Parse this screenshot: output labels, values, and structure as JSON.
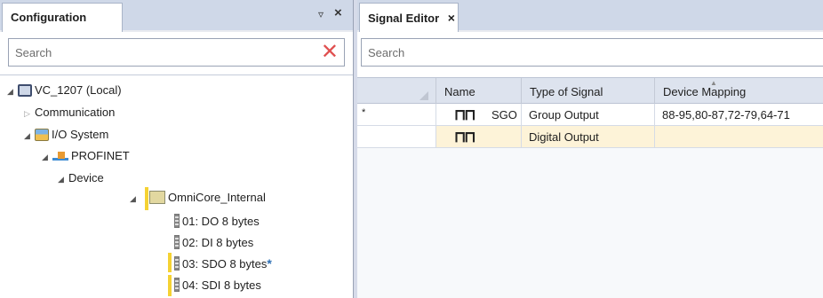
{
  "config_panel": {
    "tab_label": "Configuration",
    "pin_glyph": "⫿",
    "close_glyph": "×",
    "search_placeholder": "Search",
    "clear_glyph": "✕",
    "tree": {
      "root": "VC_1207 (Local)",
      "communication": "Communication",
      "io_system": "I/O System",
      "profinet": "PROFINET",
      "device": "Device",
      "omnicore": "OmniCore_Internal",
      "modules": [
        {
          "label": "01: DO 8 bytes",
          "modified": false,
          "highlighted": false
        },
        {
          "label": "02: DI 8 bytes",
          "modified": false,
          "highlighted": false
        },
        {
          "label": "03: SDO 8 bytes",
          "modified": true,
          "highlighted": true
        },
        {
          "label": "04: SDI 8 bytes",
          "modified": false,
          "highlighted": true
        }
      ],
      "modified_marker": "*"
    }
  },
  "signal_editor": {
    "tab_label": "Signal Editor",
    "close_glyph": "×",
    "search_placeholder": "Search",
    "columns": {
      "name": "Name",
      "type": "Type of Signal",
      "mapping": "Device Mapping"
    },
    "rows": [
      {
        "marker": "*",
        "icon": "signal-pulse-icon",
        "icon_glyph": "ΠΠ",
        "name": "SGO",
        "type": "Group Output",
        "mapping": "88-95,80-87,72-79,64-71",
        "bg": "#ffffff"
      },
      {
        "marker": "",
        "icon": "signal-pulse-icon",
        "icon_glyph": "ΠΠ",
        "name": "",
        "type": "Digital Output",
        "mapping": "",
        "bg": "#fdf3d8"
      }
    ]
  }
}
